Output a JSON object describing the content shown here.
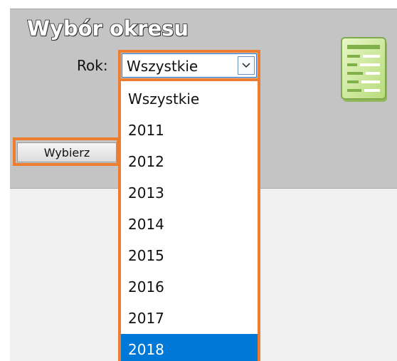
{
  "panel": {
    "title": "Wybór okresu",
    "year_label": "Rok:",
    "select": {
      "value": "Wszystkie",
      "options": [
        "Wszystkie",
        "2011",
        "2012",
        "2013",
        "2014",
        "2015",
        "2016",
        "2017",
        "2018"
      ],
      "highlighted_option": "2018"
    },
    "submit_label": "Wybierz"
  },
  "colors": {
    "panel_bg": "#c4c4c4",
    "highlight_border": "#ed7d31",
    "selected_option_bg": "#0078d7"
  },
  "icons": {
    "report": "document-list-icon",
    "dropdown_arrow": "chevron-down-icon"
  }
}
